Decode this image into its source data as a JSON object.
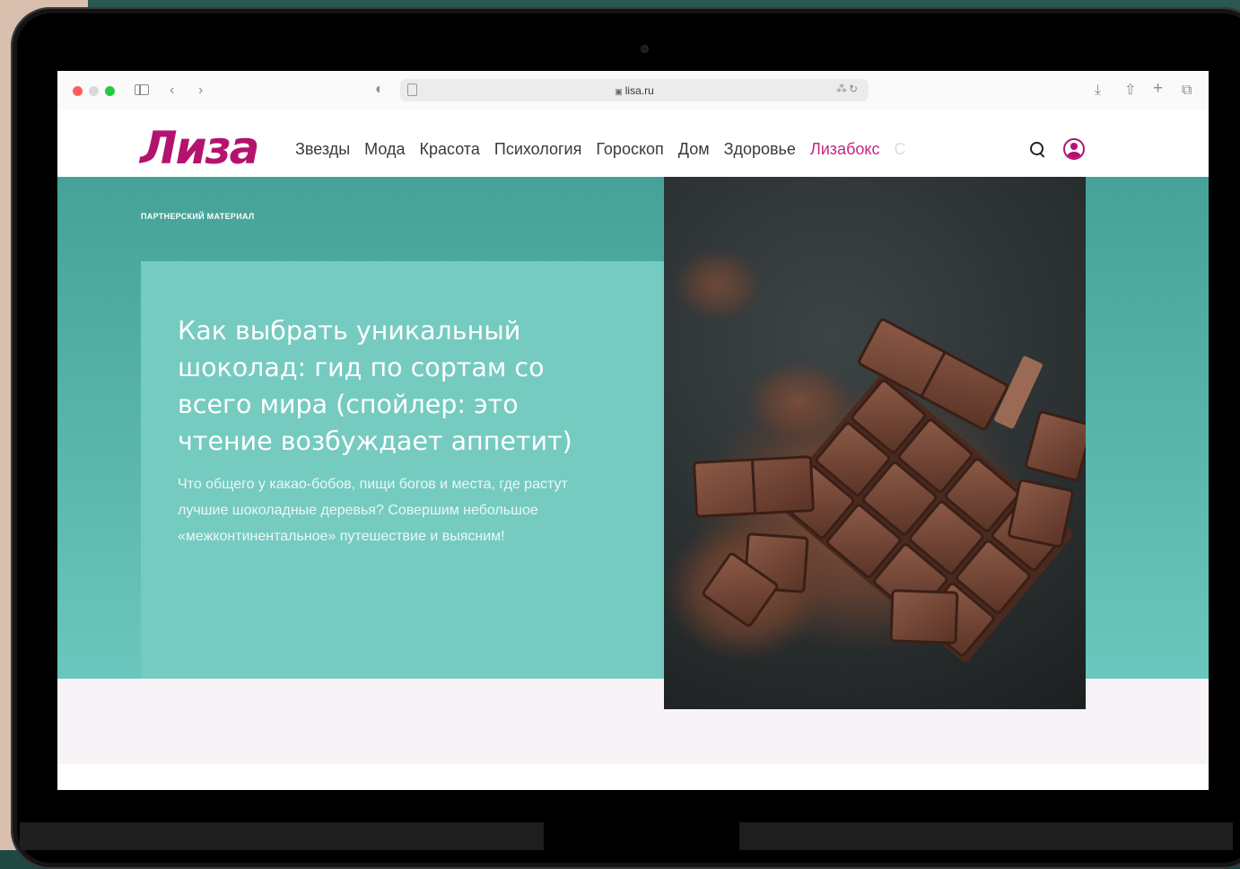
{
  "browser": {
    "url": "lisa.ru",
    "address_left_icon": "page-icon",
    "address_right_icons": "translate-icon reload-icon",
    "toolbar_icons": [
      "sidebar-icon",
      "back-icon",
      "forward-icon",
      "shield-icon",
      "download-icon",
      "share-icon",
      "new-tab-icon",
      "tabs-overview-icon"
    ]
  },
  "site": {
    "logo": "Лиза",
    "nav": [
      "Звезды",
      "Мода",
      "Красота",
      "Психология",
      "Гороскоп",
      "Дом",
      "Здоровье",
      "Лизабокс",
      "С"
    ],
    "nav_active_color": "#c5277f",
    "logo_color": "#b3136f"
  },
  "article": {
    "badge": "ПАРТНЕРСКИЙ МАТЕРИАЛ",
    "title": "Как выбрать уникальный шоколад: гид по сортам со всего мира (спойлер: это чтение возбуждает аппетит)",
    "lead": "Что общего у какао-бобов, пищи богов и места, где растут лучшие шоколадные деревья? Совершим небольшое «межконтинентальное» путешествие и выясним!",
    "accent_color": "#75cbc0"
  }
}
